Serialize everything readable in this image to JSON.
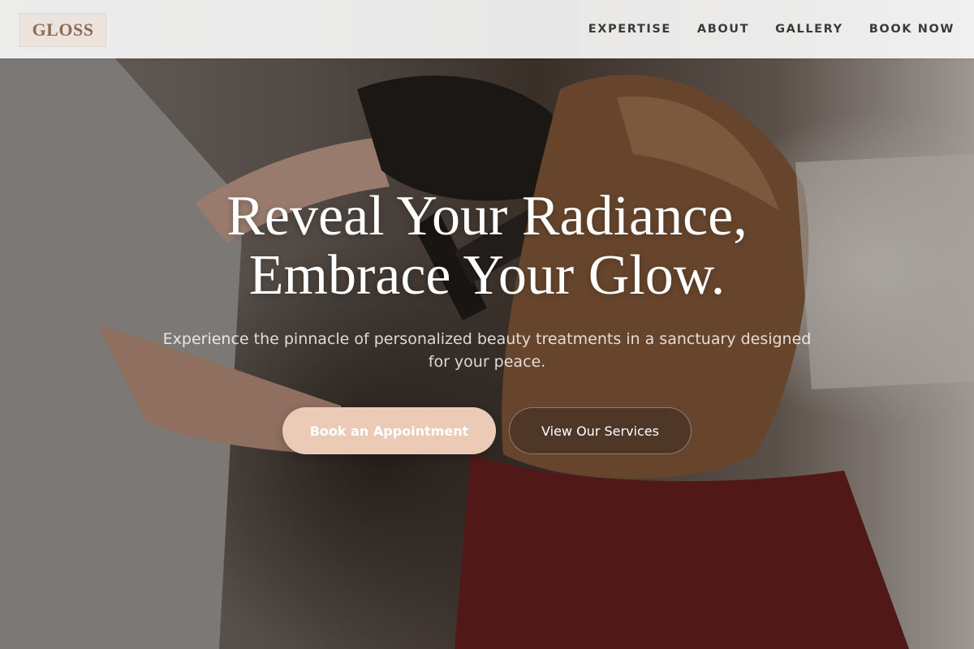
{
  "header": {
    "logo_text": "GLOSS",
    "nav": [
      {
        "label": "EXPERTISE"
      },
      {
        "label": "ABOUT"
      },
      {
        "label": "GALLERY"
      },
      {
        "label": "BOOK NOW"
      }
    ]
  },
  "hero": {
    "background_image": "hair stylist blow-drying a client's hair with a round brush",
    "title_line1": "Reveal Your Radiance,",
    "title_line2": "Embrace Your Glow.",
    "subtitle": "Experience the pinnacle of personalized beauty treatments in a sanctuary designed for your peace.",
    "primary_button": "Book an Appointment",
    "secondary_button": "View Our Services"
  },
  "colors": {
    "accent": "#eccbb6",
    "logo_text": "#8a6b56",
    "header_bg": "#f6f6f6",
    "nav_text": "#3a3a3a"
  }
}
